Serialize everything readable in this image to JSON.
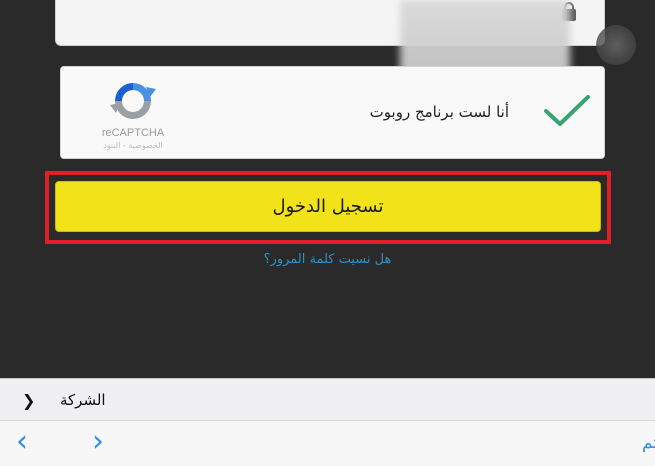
{
  "recaptcha": {
    "label": "أنا لست برنامج روبوت",
    "brand": "reCAPTCHA",
    "terms": "الخصوصية - البنود",
    "checked": true
  },
  "login": {
    "button_label": "تسجيل الدخول",
    "forgot_password": "هل نسيت كلمة المرور؟"
  },
  "bottom_bar": {
    "company_label": "الشركة",
    "company_chevron": "❯",
    "back": "‹",
    "forward": "›",
    "done_label": "تم"
  },
  "colors": {
    "login_button": "#f2e21a",
    "highlight_frame": "#e01f26",
    "link": "#2f8fc6",
    "check": "#3aa372"
  }
}
